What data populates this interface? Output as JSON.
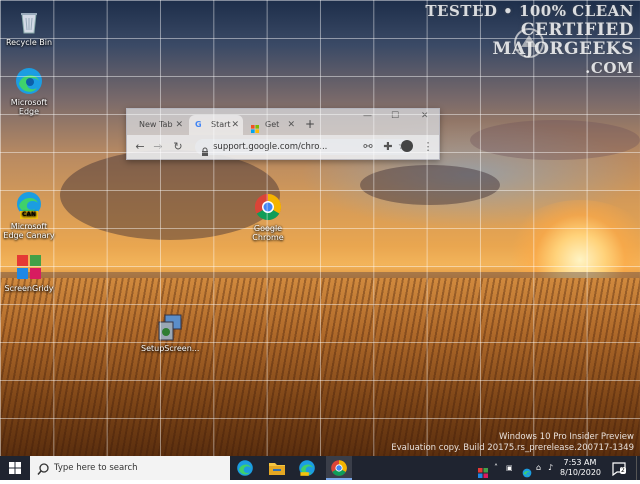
{
  "watermark": {
    "line1": "TESTED • 100% CLEAN",
    "line2": "CERTIFIED",
    "line3": "MAJORGEEKS",
    "line4": ".COM"
  },
  "desktop_icons": [
    {
      "label": "Recycle Bin",
      "icon": "recycle-bin-icon"
    },
    {
      "label": "Microsoft Edge",
      "icon": "edge-icon"
    },
    {
      "label": "Microsoft Edge Canary",
      "badge": "CAN",
      "icon": "edge-canary-icon"
    },
    {
      "label": "ScreenGridy",
      "icon": "screengridy-icon"
    },
    {
      "label": "SetupScreen...",
      "icon": "setup-icon"
    },
    {
      "label": "Google Chrome",
      "icon": "chrome-icon"
    }
  ],
  "chrome_window": {
    "tabs": [
      {
        "label": "New Tab",
        "active": false
      },
      {
        "label": "Start",
        "active": true
      },
      {
        "label": "Get",
        "active": false
      }
    ],
    "url": "support.google.com/chro...",
    "buttons": {
      "new_tab": "+",
      "minimize": "—",
      "maximize": "☐",
      "close": "✕"
    }
  },
  "windows_version": {
    "line1": "Windows 10 Pro Insider Preview",
    "line2": "Evaluation copy. Build 20175.rs_prerelease.200717-1349"
  },
  "taskbar": {
    "search_placeholder": "Type here to search",
    "time": "7:53 AM",
    "date": "8/10/2020",
    "notification_count": "2",
    "accent": "#1f2430"
  }
}
